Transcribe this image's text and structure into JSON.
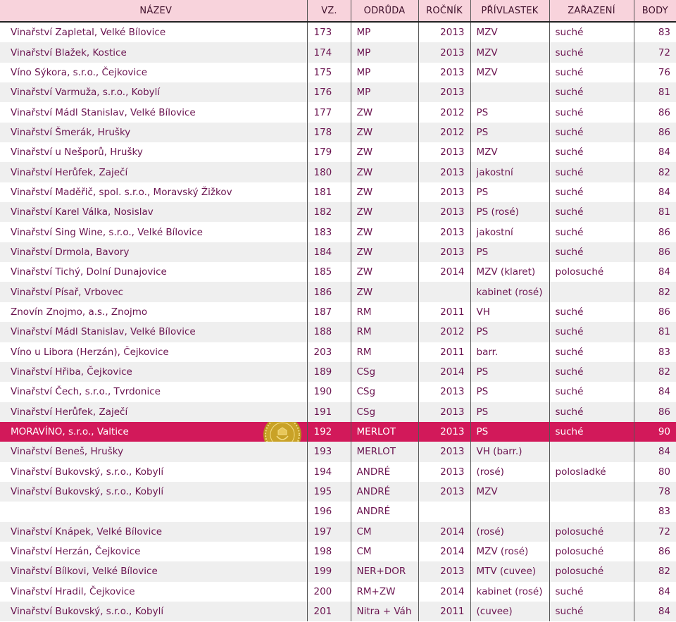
{
  "headers": {
    "nazev": "NÁZEV",
    "vz": "VZ.",
    "odruda": "ODRŮDA",
    "rocnik": "ROČNÍK",
    "privlastek": "PŘÍVLASTEK",
    "zarazeni": "ZAŘAZENÍ",
    "body": "BODY"
  },
  "colors": {
    "header_bg": "#f8d3dc",
    "text": "#6b1450",
    "stripe": "#efefef",
    "highlight_bg": "#d2195a",
    "medal": "#c9a227"
  },
  "highlight_row": 20,
  "medal_icon": "gold-medal-icon",
  "rows": [
    {
      "nazev": "Vinařství Zapletal, Velké Bílovice",
      "vz": "173",
      "odruda": "MP",
      "rocnik": "2013",
      "privlastek": "MZV",
      "zarazeni": "suché",
      "body": "83"
    },
    {
      "nazev": "Vinařství Blažek, Kostice",
      "vz": "174",
      "odruda": "MP",
      "rocnik": "2013",
      "privlastek": "MZV",
      "zarazeni": "suché",
      "body": "72"
    },
    {
      "nazev": "Víno Sýkora, s.r.o., Čejkovice",
      "vz": "175",
      "odruda": "MP",
      "rocnik": "2013",
      "privlastek": "MZV",
      "zarazeni": "suché",
      "body": "76"
    },
    {
      "nazev": "Vinařství Varmuža, s.r.o., Kobylí",
      "vz": "176",
      "odruda": "MP",
      "rocnik": "2013",
      "privlastek": "",
      "zarazeni": "suché",
      "body": "81"
    },
    {
      "nazev": "Vinařství Mádl Stanislav, Velké Bílovice",
      "vz": "177",
      "odruda": "ZW",
      "rocnik": "2012",
      "privlastek": "PS",
      "zarazeni": "suché",
      "body": "86"
    },
    {
      "nazev": "Vinařství Šmerák, Hrušky",
      "vz": "178",
      "odruda": "ZW",
      "rocnik": "2012",
      "privlastek": "PS",
      "zarazeni": "suché",
      "body": "86"
    },
    {
      "nazev": "Vinařství u Nešporů, Hrušky",
      "vz": "179",
      "odruda": "ZW",
      "rocnik": "2013",
      "privlastek": "MZV",
      "zarazeni": "suché",
      "body": "84"
    },
    {
      "nazev": "Vinařství Herůfek, Zaječí",
      "vz": "180",
      "odruda": "ZW",
      "rocnik": "2013",
      "privlastek": "jakostní",
      "zarazeni": "suché",
      "body": "82"
    },
    {
      "nazev": "Vinařství Maděřič, spol. s.r.o., Moravský Žižkov",
      "vz": "181",
      "odruda": "ZW",
      "rocnik": "2013",
      "privlastek": "PS",
      "zarazeni": "suché",
      "body": "84"
    },
    {
      "nazev": "Vinařství Karel Válka, Nosislav",
      "vz": "182",
      "odruda": "ZW",
      "rocnik": "2013",
      "privlastek": "PS (rosé)",
      "zarazeni": "suché",
      "body": "81"
    },
    {
      "nazev": "Vinařství Sing Wine, s.r.o., Velké Bílovice",
      "vz": "183",
      "odruda": "ZW",
      "rocnik": "2013",
      "privlastek": "jakostní",
      "zarazeni": "suché",
      "body": "86"
    },
    {
      "nazev": "Vinařství Drmola, Bavory",
      "vz": "184",
      "odruda": "ZW",
      "rocnik": "2013",
      "privlastek": "PS",
      "zarazeni": "suché",
      "body": "86"
    },
    {
      "nazev": "Vinařství Tichý, Dolní Dunajovice",
      "vz": "185",
      "odruda": "ZW",
      "rocnik": "2014",
      "privlastek": "MZV (klaret)",
      "zarazeni": "polosuché",
      "body": "84"
    },
    {
      "nazev": "Vinařství Písař, Vrbovec",
      "vz": "186",
      "odruda": "ZW",
      "rocnik": "",
      "privlastek": "kabinet (rosé)",
      "zarazeni": "",
      "body": "82"
    },
    {
      "nazev": "Znovín Znojmo, a.s., Znojmo",
      "vz": "187",
      "odruda": "RM",
      "rocnik": "2011",
      "privlastek": "VH",
      "zarazeni": "suché",
      "body": "86"
    },
    {
      "nazev": "Vinařství Mádl Stanislav, Velké Bílovice",
      "vz": "188",
      "odruda": "RM",
      "rocnik": "2012",
      "privlastek": "PS",
      "zarazeni": "suché",
      "body": "81"
    },
    {
      "nazev": "Víno u Libora (Herzán), Čejkovice",
      "vz": "203",
      "odruda": "RM",
      "rocnik": "2011",
      "privlastek": "barr.",
      "zarazeni": "suché",
      "body": "83"
    },
    {
      "nazev": "Vinařství Hřiba, Čejkovice",
      "vz": "189",
      "odruda": "CSg",
      "rocnik": "2014",
      "privlastek": "PS",
      "zarazeni": "suché",
      "body": "82"
    },
    {
      "nazev": "Vinařství Čech, s.r.o., Tvrdonice",
      "vz": "190",
      "odruda": "CSg",
      "rocnik": "2013",
      "privlastek": "PS",
      "zarazeni": "suché",
      "body": "84"
    },
    {
      "nazev": "Vinařství Herůfek, Zaječí",
      "vz": "191",
      "odruda": "CSg",
      "rocnik": "2013",
      "privlastek": "PS",
      "zarazeni": "suché",
      "body": "86"
    },
    {
      "nazev": "MORAVÍNO, s.r.o., Valtice",
      "vz": "192",
      "odruda": "MERLOT",
      "rocnik": "2013",
      "privlastek": "PS",
      "zarazeni": "suché",
      "body": "90"
    },
    {
      "nazev": "Vinařství Beneš, Hrušky",
      "vz": "193",
      "odruda": "MERLOT",
      "rocnik": "2013",
      "privlastek": "VH (barr.)",
      "zarazeni": "",
      "body": "84"
    },
    {
      "nazev": "Vinařství Bukovský, s.r.o., Kobylí",
      "vz": "194",
      "odruda": "ANDRÉ",
      "rocnik": "2013",
      "privlastek": "(rosé)",
      "zarazeni": "polosladké",
      "body": "80"
    },
    {
      "nazev": "Vinařství Bukovský, s.r.o., Kobylí",
      "vz": "195",
      "odruda": "ANDRÉ",
      "rocnik": "2013",
      "privlastek": "MZV",
      "zarazeni": "",
      "body": "78"
    },
    {
      "nazev": "",
      "vz": "196",
      "odruda": "ANDRÉ",
      "rocnik": "",
      "privlastek": "",
      "zarazeni": "",
      "body": "83"
    },
    {
      "nazev": "Vinařství Knápek, Velké Bílovice",
      "vz": "197",
      "odruda": "CM",
      "rocnik": "2014",
      "privlastek": "(rosé)",
      "zarazeni": "polosuché",
      "body": "72"
    },
    {
      "nazev": "Vinařství Herzán, Čejkovice",
      "vz": "198",
      "odruda": "CM",
      "rocnik": "2014",
      "privlastek": "MZV (rosé)",
      "zarazeni": "polosuché",
      "body": "86"
    },
    {
      "nazev": "Vinařství Bílkovi, Velké Bílovice",
      "vz": "199",
      "odruda": "NER+DOR",
      "rocnik": "2013",
      "privlastek": "MTV (cuvee)",
      "zarazeni": "polosuché",
      "body": "82"
    },
    {
      "nazev": "Vinařství Hradil, Čejkovice",
      "vz": "200",
      "odruda": "RM+ZW",
      "rocnik": "2014",
      "privlastek": "kabinet (rosé)",
      "zarazeni": "suché",
      "body": "84"
    },
    {
      "nazev": "Vinařství Bukovský, s.r.o., Kobylí",
      "vz": "201",
      "odruda": "Nitra + Váh",
      "rocnik": "2011",
      "privlastek": "(cuvee)",
      "zarazeni": "suché",
      "body": "84"
    }
  ]
}
